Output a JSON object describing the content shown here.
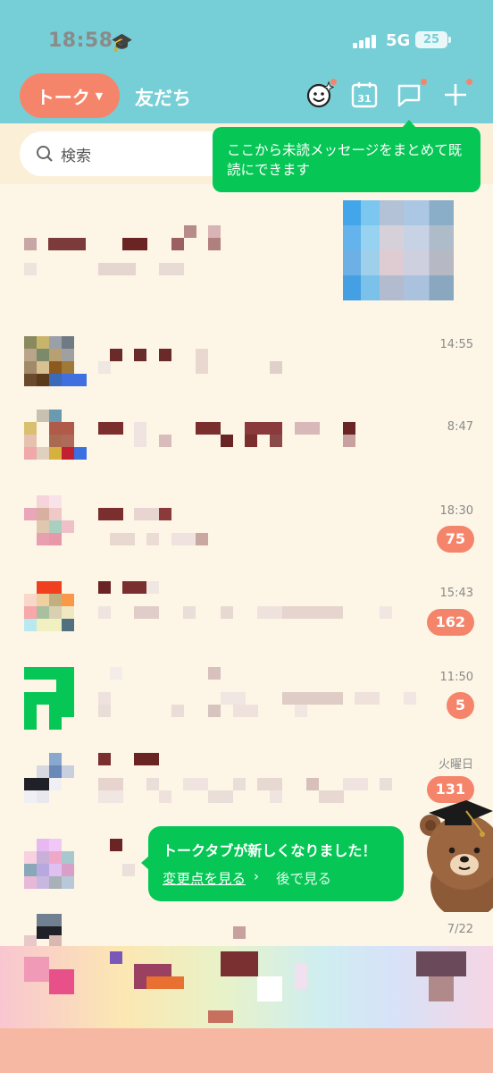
{
  "status_bar": {
    "time": "18:58",
    "network": "5G",
    "battery": "25"
  },
  "header": {
    "tab_talk": "トーク",
    "tab_friends": "友だち",
    "icons": [
      "face-sparkle-icon",
      "calendar-icon",
      "chat-bubble-icon",
      "plus-icon"
    ],
    "calendar_day": "31"
  },
  "search": {
    "placeholder": "検索"
  },
  "tooltip": {
    "text": "ここから未読メッセージをまとめて既読にできます"
  },
  "chats": [
    {
      "time": "",
      "badge": ""
    },
    {
      "time": "14:55",
      "badge": ""
    },
    {
      "time": "8:47",
      "badge": ""
    },
    {
      "time": "18:30",
      "badge": "75"
    },
    {
      "time": "15:43",
      "badge": "162"
    },
    {
      "time": "11:50",
      "badge": "5"
    },
    {
      "time": "火曜日",
      "badge": "131"
    },
    {
      "time": "",
      "badge": ""
    },
    {
      "time": "7/22",
      "badge": ""
    }
  ],
  "notice": {
    "title": "トークタブが新しくなりました！",
    "link": "変更点を見る",
    "later": "後で見る"
  },
  "colors": {
    "accent": "#f5856a",
    "line_green": "#06c755",
    "header_bg": "#76cfd6"
  }
}
